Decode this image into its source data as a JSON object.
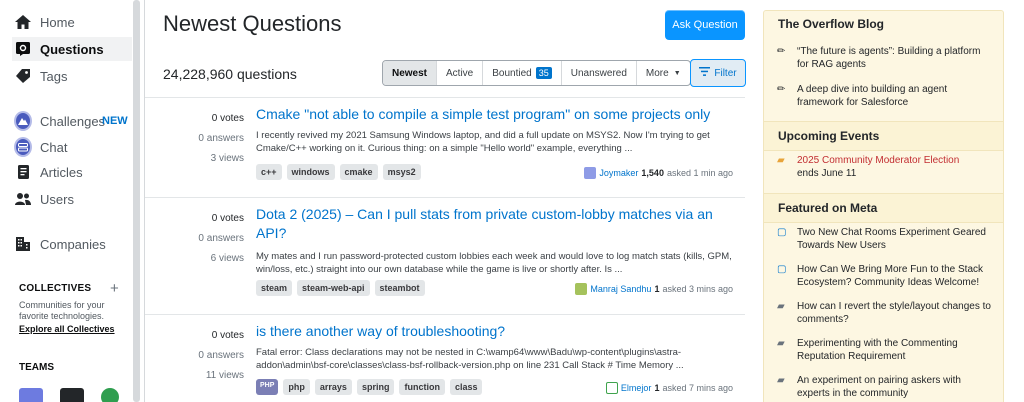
{
  "sidebar": {
    "items": [
      {
        "label": "Home",
        "icon": "home-icon"
      },
      {
        "label": "Questions",
        "icon": "questions-icon"
      },
      {
        "label": "Tags",
        "icon": "tag-icon"
      },
      {
        "label": "Challenges",
        "icon": "challenges-icon",
        "badge": "NEW"
      },
      {
        "label": "Chat",
        "icon": "chat-icon"
      },
      {
        "label": "Articles",
        "icon": "articles-icon"
      },
      {
        "label": "Users",
        "icon": "users-icon"
      },
      {
        "label": "Companies",
        "icon": "companies-icon"
      }
    ],
    "collectives_title": "COLLECTIVES",
    "collectives_desc": "Communities for your favorite technologies.",
    "collectives_link": "Explore all Collectives",
    "teams_title": "TEAMS"
  },
  "main": {
    "title": "Newest Questions",
    "ask_button": "Ask Question",
    "question_count": "24,228,960 questions",
    "tabs": [
      {
        "label": "Newest"
      },
      {
        "label": "Active"
      },
      {
        "label": "Bountied",
        "count": "35"
      },
      {
        "label": "Unanswered"
      },
      {
        "label": "More"
      }
    ],
    "filter_button": "Filter",
    "questions": [
      {
        "votes": "0 votes",
        "answers": "0 answers",
        "views": "3 views",
        "title": "Cmake \"not able to compile a simple test program\" on some projects only",
        "excerpt": "I recently revived my 2021 Samsung Windows laptop, and did a full update on MSYS2. Now I'm trying to get Cmake/C++ working on it. Curious thing: on a simple \"Hello world\" example, everything ...",
        "tags": [
          "c++",
          "windows",
          "cmake",
          "msys2"
        ],
        "user": "Joymaker",
        "rep": "1,540",
        "time": "asked 1 min ago"
      },
      {
        "votes": "0 votes",
        "answers": "0 answers",
        "views": "6 views",
        "title": "Dota 2 (2025) – Can I pull stats from private custom-lobby matches via an API?",
        "excerpt": "My mates and I run password-protected custom lobbies each week and would love to log match stats (kills, GPM, win/loss, etc.) straight into our own database while the game is live or shortly after. Is ...",
        "tags": [
          "steam",
          "steam-web-api",
          "steambot"
        ],
        "user": "Manraj Sandhu",
        "rep": "1",
        "time": "asked 3 mins ago"
      },
      {
        "votes": "0 votes",
        "answers": "0 answers",
        "views": "11 views",
        "title": "is there another way of troubleshooting?",
        "excerpt": "Fatal error: Class declarations may not be nested in C:\\wamp64\\www\\Badu\\wp-content\\plugins\\astra-addon\\admin\\bsf-core\\classes\\class-bsf-rollback-version.php on line 231 Call Stack # Time Memory ...",
        "tags": [
          "php",
          "arrays",
          "spring",
          "function",
          "class"
        ],
        "php_badge": "PHP",
        "user": "Elmejor",
        "rep": "1",
        "time": "asked 7 mins ago"
      }
    ]
  },
  "right": {
    "blog_title": "The Overflow Blog",
    "blog_items": [
      "“The future is agents”: Building a platform for RAG agents",
      "A deep dive into building an agent framework for Salesforce"
    ],
    "events_title": "Upcoming Events",
    "event_link": "2025 Community Moderator Election",
    "event_sub": "ends June 11",
    "meta_title": "Featured on Meta",
    "meta_items": [
      "Two New Chat Rooms Experiment Geared Towards New Users",
      "How Can We Bring More Fun to the Stack Ecosystem? Community Ideas Welcome!",
      "How can I revert the style/layout changes to comments?",
      "Experimenting with the Commenting Reputation Requirement",
      "An experiment on pairing askers with experts in the community"
    ]
  }
}
